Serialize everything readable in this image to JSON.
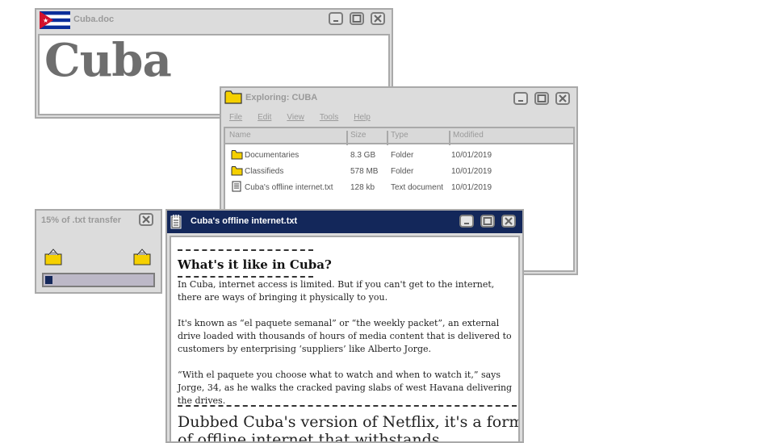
{
  "doc_window": {
    "title": "Cuba.doc",
    "heading": "Cuba"
  },
  "explorer_window": {
    "title": "Exploring: CUBA",
    "menu": [
      "File",
      "Edit",
      "View",
      "Tools",
      "Help"
    ],
    "columns": [
      "Name",
      "Size",
      "Type",
      "Modified"
    ],
    "rows": [
      {
        "icon": "folder-icon",
        "name": "Documentaries",
        "size": "8.3 GB",
        "type": "Folder",
        "modified": "10/01/2019"
      },
      {
        "icon": "folder-icon",
        "name": "Classifieds",
        "size": "578 MB",
        "type": "Folder",
        "modified": "10/01/2019"
      },
      {
        "icon": "text-file-icon",
        "name": "Cuba's offline internet.txt",
        "size": "128 kb",
        "type": "Text document",
        "modified": "10/01/2019"
      }
    ]
  },
  "transfer_window": {
    "title": "15% of .txt transfer",
    "progress": 0.07
  },
  "text_window": {
    "title": "Cuba's offline internet.txt",
    "heading": "What's it like in Cuba?",
    "paragraphs": [
      "In Cuba, internet access is limited. But if you can't get to the internet, there are ways of bringing it physically to you.",
      "It's known as “el paquete semanal” or “the weekly packet”, an external drive loaded with thousands of hours of media content that is delivered to customers by enterprising ‘suppliers’ like Alberto Jorge.",
      "“With el paquete you choose what to watch and when to watch it,” says Jorge, 34, as he walks the cracked paving slabs of west Havana delivering the drives."
    ],
    "callout": "Dubbed Cuba's version of Netflix, it's a form of offline internet that withstands"
  },
  "colors": {
    "titlebar_active": "#13275a",
    "folder": "#f5d000",
    "window_gray": "#dcdcdc"
  }
}
